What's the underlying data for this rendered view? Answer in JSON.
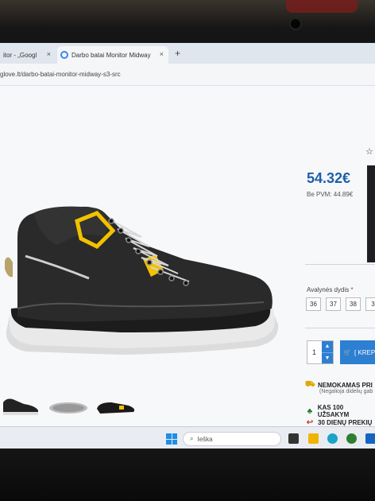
{
  "browser": {
    "tabs": [
      {
        "label": "itor - „Googl"
      },
      {
        "label": "Darbo batai Monitor Midway"
      }
    ],
    "tab_close": "×",
    "new_tab": "+",
    "url": "glove.lt/darbo-batai-monitor-midway-s3-src"
  },
  "product": {
    "price": "54.32€",
    "price_without_vat": "Be PVM: 44.89€",
    "size_label": "Avalynės dydis",
    "required_mark": "*",
    "sizes": [
      "36",
      "37",
      "38",
      "3"
    ],
    "quantity": "1",
    "add_to_cart": "[ KREPŠ",
    "perks": [
      {
        "icon": "truck-icon",
        "text": "NEMOKAMAS PRI"
      },
      {
        "icon": "tree-icon",
        "text": "KAS 100 UŽSAKYM"
      },
      {
        "icon": "return-icon",
        "text": "30 DIENŲ PREKIŲ"
      }
    ],
    "perk_note": "(Negalioja didelių gab"
  },
  "taskbar": {
    "search_placeholder": "Ieška"
  },
  "colors": {
    "price": "#1f5fa8",
    "button": "#2c7fd1",
    "boot_accent": "#f2c200"
  }
}
